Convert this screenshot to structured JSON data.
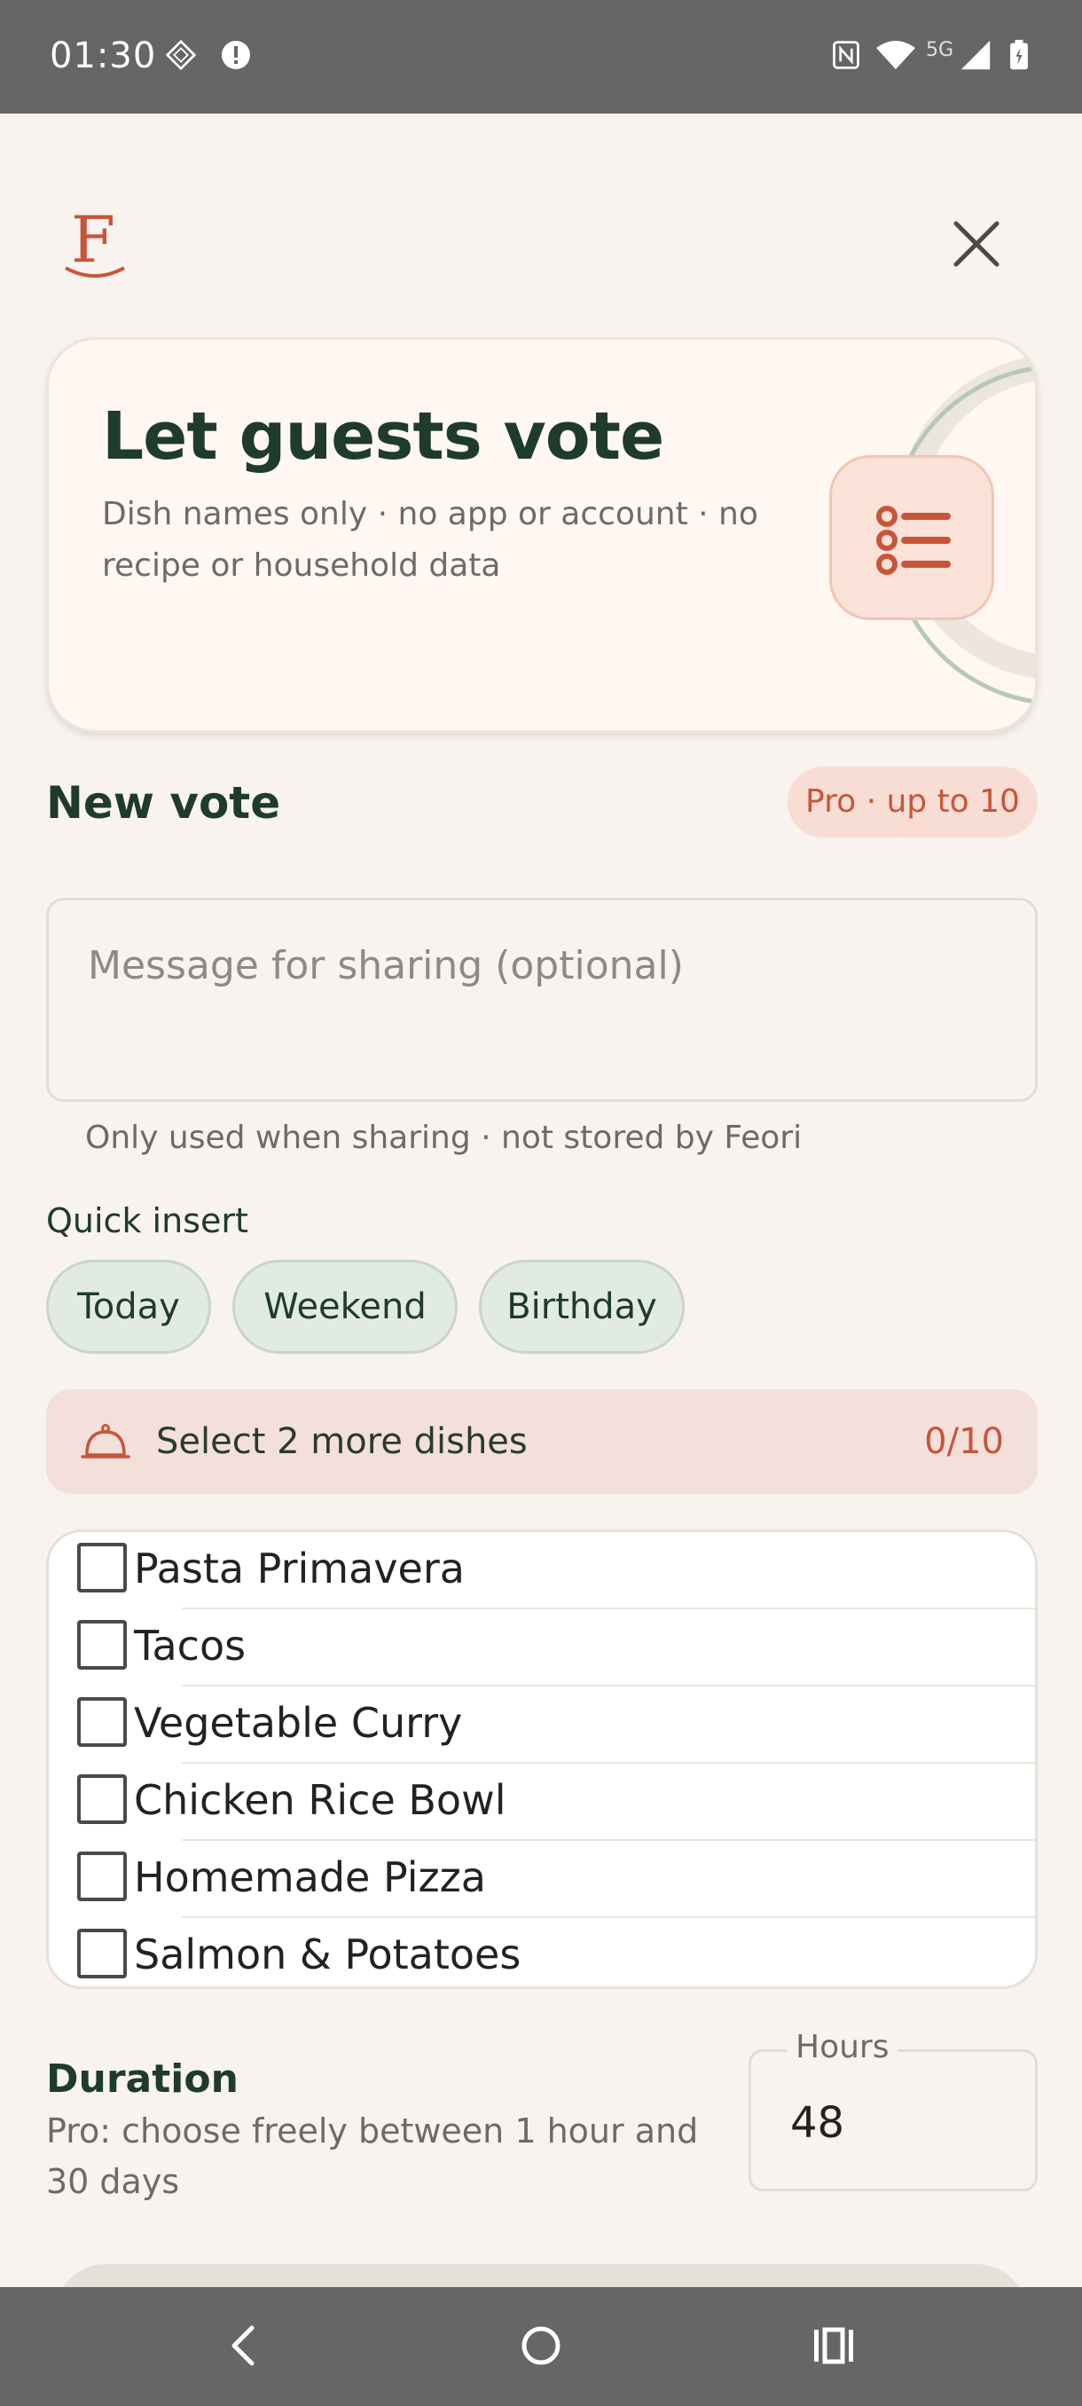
{
  "status_bar": {
    "time": "01:30",
    "network": "5G"
  },
  "header": {
    "logo_letter": "F",
    "close_icon": "close-icon"
  },
  "hero": {
    "title": "Let guests vote",
    "subtitle": "Dish names only · no app or account · no recipe or household data",
    "icon": "list-icon"
  },
  "new_vote": {
    "title": "New vote",
    "pro_badge": "Pro · up to 10",
    "message_placeholder": "Message for sharing (optional)",
    "message_value": "",
    "helper": "Only used when sharing · not stored by Feori"
  },
  "quick_insert": {
    "label": "Quick insert",
    "chips": [
      "Today",
      "Weekend",
      "Birthday"
    ]
  },
  "selection": {
    "text": "Select 2 more dishes",
    "count": "0/10",
    "icon": "cloche-icon"
  },
  "dishes": [
    {
      "name": "Pasta Primavera",
      "checked": false
    },
    {
      "name": "Tacos",
      "checked": false
    },
    {
      "name": "Vegetable Curry",
      "checked": false
    },
    {
      "name": "Chicken Rice Bowl",
      "checked": false
    },
    {
      "name": "Homemade Pizza",
      "checked": false
    },
    {
      "name": "Salmon & Potatoes",
      "checked": false
    }
  ],
  "duration": {
    "title": "Duration",
    "subtitle": "Pro: choose freely between 1 hour and 30 days",
    "hours_label": "Hours",
    "hours_value": "48"
  },
  "colors": {
    "accent": "#c8553a",
    "dark_green": "#1f3a2e",
    "background": "#f8f3ee",
    "chip_bg": "#e2ebe1"
  }
}
